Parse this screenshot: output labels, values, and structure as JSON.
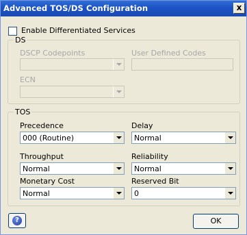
{
  "window": {
    "title": "Advanced TOS/DS Configuration",
    "close_glyph": "x"
  },
  "enable_ds": {
    "label": "Enable Differentiated Services",
    "checked": false
  },
  "ds": {
    "title": "DS",
    "dscp_label": "DSCP Codepoints",
    "dscp_value": "",
    "user_defined_label": "User Defined Codes",
    "user_defined_value": "",
    "ecn_label": "ECN",
    "ecn_value": ""
  },
  "tos": {
    "title": "TOS",
    "precedence": {
      "label": "Precedence",
      "value": "000 (Routine)"
    },
    "delay": {
      "label": "Delay",
      "value": "Normal"
    },
    "throughput": {
      "label": "Throughput",
      "value": "Normal"
    },
    "reliability": {
      "label": "Reliability",
      "value": "Normal"
    },
    "monetary_cost": {
      "label": "Monetary Cost",
      "value": "Normal"
    },
    "reserved_bit": {
      "label": "Reserved Bit",
      "value": "0"
    }
  },
  "buttons": {
    "help_glyph": "?",
    "ok": "OK"
  }
}
